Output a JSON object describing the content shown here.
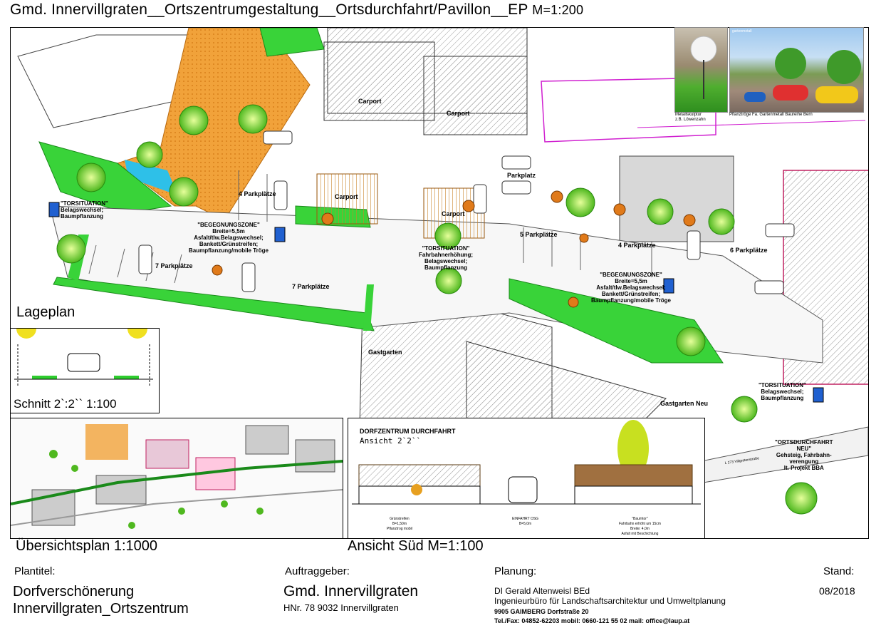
{
  "title": {
    "main": "Gmd. Innervillgraten__Ortszentrumgestaltung__Ortsdurchfahrt/Pavillon__EP",
    "scale": "M=1:200"
  },
  "photos": {
    "left_caption": [
      "Metallskulptur",
      "z.B. Löwenzahn"
    ],
    "right_caption": "Pflanztröge Fa. Gartenmetall Baureihe Bern",
    "right_note": "gartenmetall"
  },
  "lageplan": {
    "label": "Lageplan",
    "buildings": {
      "carport_1": "Carport",
      "carport_2": "Carport",
      "carport_3": "Carport",
      "carport_4": "Carport",
      "carport_top": "Carport",
      "carport_top2": "Carport",
      "gastgarten": "Gastgarten",
      "gastgarten_neu": "Gastgarten Neu",
      "parkplatz": "Parkplatz"
    },
    "parking": {
      "p1": "4 Parkplätze",
      "p2": "7 Parkplätze",
      "p3": "7 Parkplätze",
      "p4": "5 Parkplätze",
      "p5": "4 Parkplätze",
      "p6": "6 Parkplätze"
    },
    "annotations": {
      "tor1": [
        "\"TORSITUATION\"",
        "Belagswechsel;",
        "Baumpflanzung"
      ],
      "begegnung1": [
        "\"BEGEGNUNGSZONE\"",
        "Breite=5,5m",
        "Asfalt/tlw.Belagswechsel;",
        "Bankett/Grünstreifen;",
        "Baumpflanzung/mobile Tröge"
      ],
      "tor2": [
        "\"TORSITUATION\"",
        "Fahrbahnerhöhung;",
        "Belagswechsel;",
        "Baumpflanzung"
      ],
      "begegnung2": [
        "\"BEGEGNUNGSZONE\"",
        "Breite=5,5m",
        "Asfalt/tlw.Belagswechsel;",
        "Bankett/Grünstreifen;",
        "Baumpflanzung/mobile Tröge"
      ],
      "tor3": [
        "\"TORSITUATION\"",
        "Belagswechsel;",
        "Baumpflanzung"
      ],
      "ortsdurchfahrt": [
        "\"ORTSDURCHFAHRT",
        "NEU\"",
        "Gehsteig, Fahrbahn-",
        "verengung",
        "lt.  Projekt BBA"
      ]
    },
    "road": "L 273 Villgratenstraße"
  },
  "schnitt": {
    "label": "Schnitt 2`:2`` 1:100"
  },
  "uebersicht": {
    "label": "Übersichtsplan 1:1000"
  },
  "ansicht": {
    "label": "Ansicht Süd M=1:100",
    "heading": "DORFZENTRUM DURCHFAHRT",
    "sub": "Ansicht 2`2``",
    "notes": [
      "Grünstreifen",
      "B=1,50m",
      "Pflanztrog mobil",
      "EINFAHRT OSG",
      "B=5,0m",
      "\"Baumtor\"",
      "Fahrbahn erhöht um 15cm",
      "Breite: 4,0m",
      "Asfalt mit Beschichtung"
    ]
  },
  "titleblock": {
    "plantitel_h": "Plantitel:",
    "plantitel": [
      "Dorfverschönerung",
      "Innervillgraten_Ortszentrum"
    ],
    "auftrag_h": "Auftraggeber:",
    "auftrag": "Gmd. Innervillgraten",
    "auftrag_addr": "HNr. 78 9032 Innervillgraten",
    "planung_h": "Planung:",
    "planung": [
      "DI Gerald Altenweisl BEd",
      "Ingenieurbüro für Landschaftsarchitektur und Umweltplanung"
    ],
    "planung_addr": "9905 GAIMBERG Dorfstraße 20",
    "planung_contact": "Tel./Fax: 04852-62203 mobil: 0660-121 55 02 mail: office@laup.at",
    "stand_h": "Stand:",
    "stand": "08/2018"
  },
  "colors": {
    "green": "#2ecc2e",
    "orange": "#f0a030",
    "magenta": "#d020d0",
    "tree": "#7ed321"
  }
}
